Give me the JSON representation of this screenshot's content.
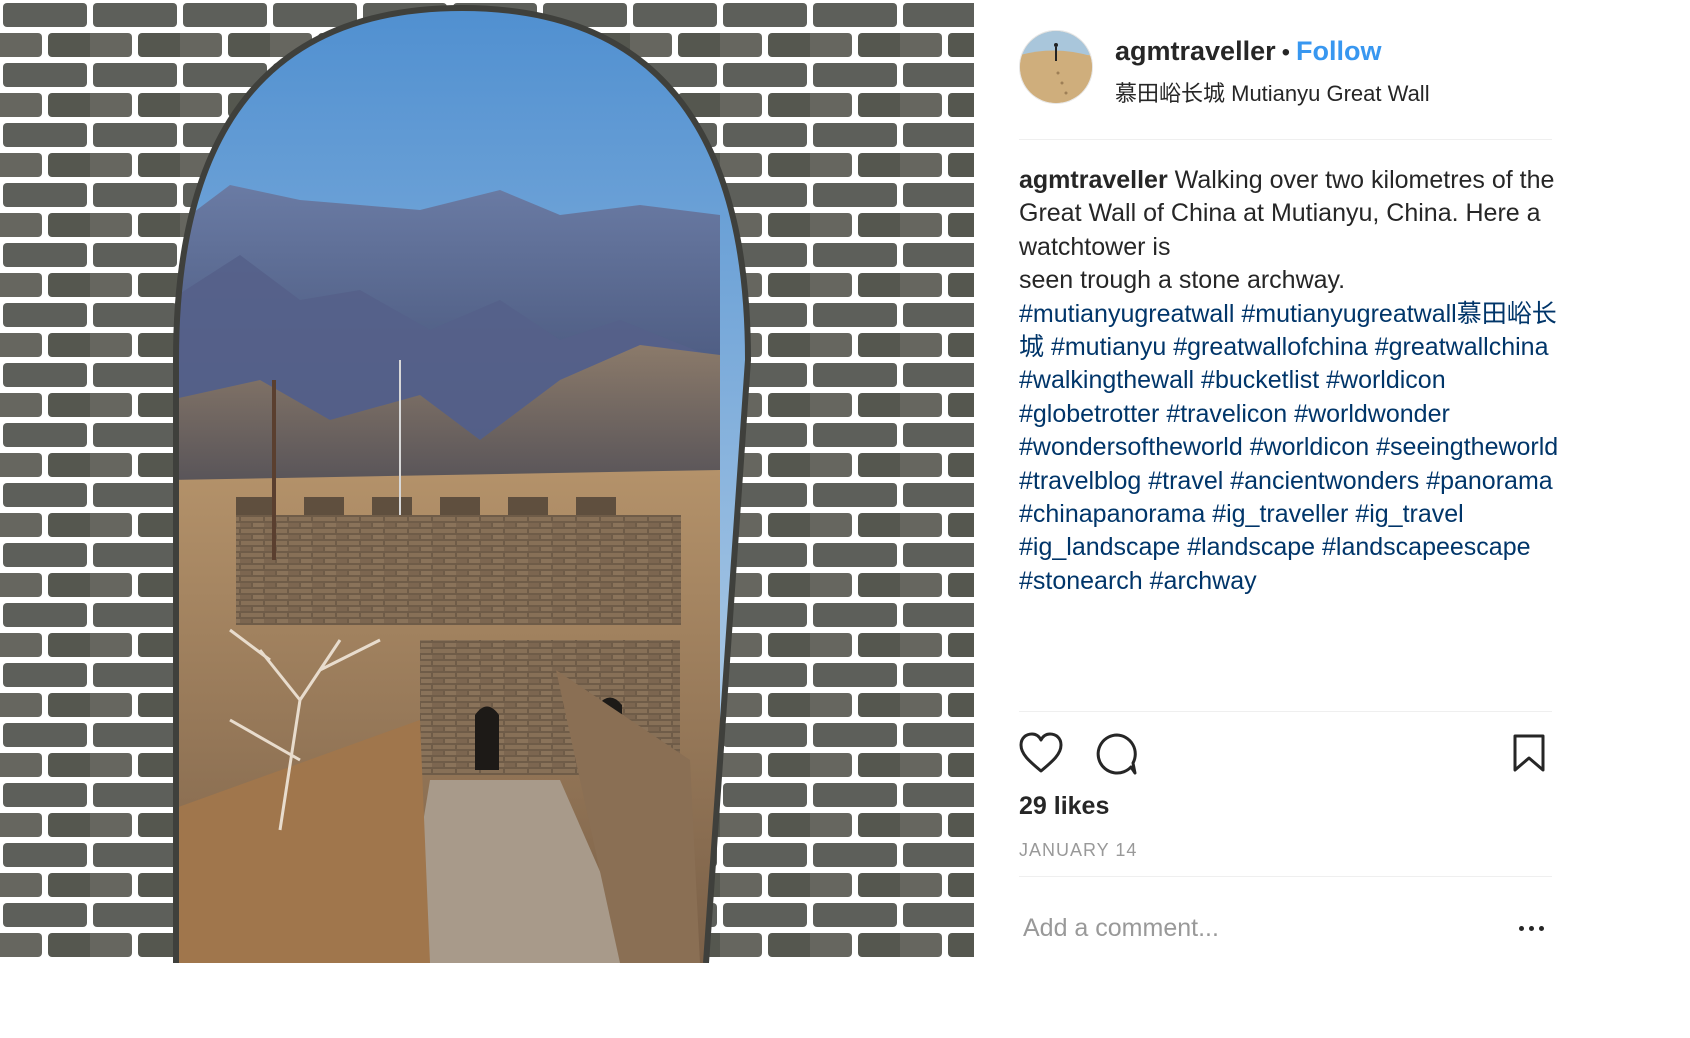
{
  "post": {
    "image_alt": "Great Wall watchtower seen through a stone archway",
    "username": "agmtraveller",
    "separator": "•",
    "follow_label": "Follow",
    "location": "慕田峪长城 Mutianyu Great Wall",
    "caption": {
      "username": "agmtraveller",
      "text_line1": "Walking over two kilometres of the Great Wall of China at Mutianyu, China. Here a watchtower is",
      "text_line2": "seen trough a stone archway.",
      "hashtags": "#mutianyugreatwall #mutianyugreatwall慕田峪长城 #mutianyu #greatwallofchina #greatwallchina #walkingthewall #bucketlist #worldicon #globetrotter #travelicon #worldwonder #wondersoftheworld #worldicon #seeingtheworld #travelblog #travel #ancientwonders #panorama #chinapanorama #ig_traveller #ig_travel #ig_landscape #landscape #landscapeescape #stonearch #archway"
    },
    "icons": {
      "like": "heart-icon",
      "comment": "comment-bubble-icon",
      "save": "bookmark-icon",
      "more": "more-options-icon"
    },
    "likes_text": "29 likes",
    "date": "JANUARY 14",
    "comment_placeholder": "Add a comment..."
  },
  "colors": {
    "link_blue": "#3897f0",
    "hashtag": "#003569",
    "text": "#262626",
    "muted": "#999999",
    "divider": "#efefef"
  }
}
